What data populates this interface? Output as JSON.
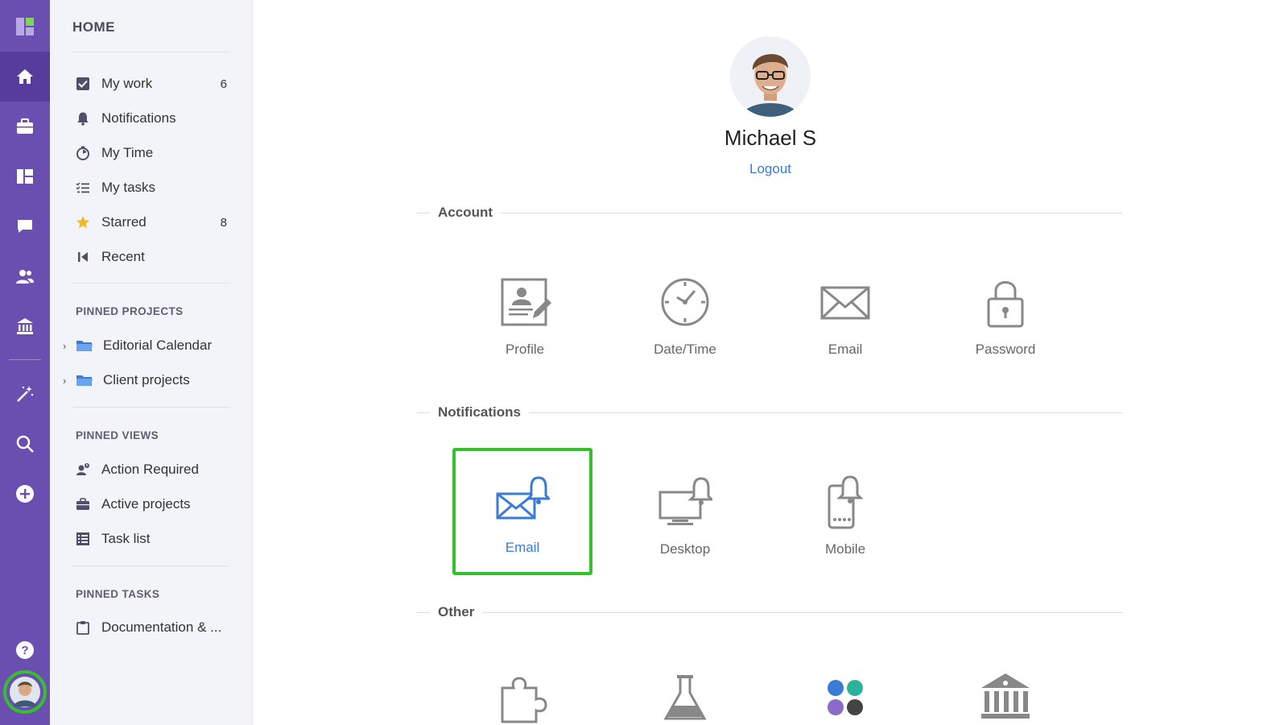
{
  "sidebar": {
    "home_title": "HOME",
    "items": [
      {
        "label": "My work",
        "count": "6",
        "icon": "checkbox-icon"
      },
      {
        "label": "Notifications",
        "count": "",
        "icon": "bell-icon"
      },
      {
        "label": "My Time",
        "count": "",
        "icon": "stopwatch-icon"
      },
      {
        "label": "My tasks",
        "count": "",
        "icon": "checklist-icon"
      },
      {
        "label": "Starred",
        "count": "8",
        "icon": "star-icon"
      },
      {
        "label": "Recent",
        "count": "",
        "icon": "skip-back-icon"
      }
    ],
    "pinned_projects": {
      "title": "PINNED PROJECTS",
      "items": [
        {
          "label": "Editorial Calendar",
          "icon": "folder-icon"
        },
        {
          "label": "Client projects",
          "icon": "folder-icon"
        }
      ]
    },
    "pinned_views": {
      "title": "PINNED VIEWS",
      "items": [
        {
          "label": "Action Required",
          "icon": "user-alert-icon"
        },
        {
          "label": "Active projects",
          "icon": "briefcase-icon"
        },
        {
          "label": "Task list",
          "icon": "table-icon"
        }
      ]
    },
    "pinned_tasks": {
      "title": "PINNED TASKS",
      "items": [
        {
          "label": "Documentation & ...",
          "icon": "clipboard-icon"
        }
      ]
    }
  },
  "user": {
    "name": "Michael S",
    "logout_label": "Logout"
  },
  "sections": {
    "account": {
      "title": "Account",
      "tiles": [
        {
          "label": "Profile",
          "icon": "profile-card-icon"
        },
        {
          "label": "Date/Time",
          "icon": "clock-icon"
        },
        {
          "label": "Email",
          "icon": "envelope-icon"
        },
        {
          "label": "Password",
          "icon": "padlock-icon"
        }
      ]
    },
    "notifications": {
      "title": "Notifications",
      "tiles": [
        {
          "label": "Email",
          "icon": "email-bell-icon",
          "selected": true
        },
        {
          "label": "Desktop",
          "icon": "desktop-bell-icon"
        },
        {
          "label": "Mobile",
          "icon": "mobile-bell-icon"
        }
      ]
    },
    "other": {
      "title": "Other",
      "tiles": [
        {
          "icon": "puzzle-icon"
        },
        {
          "icon": "flask-icon"
        },
        {
          "icon": "color-dots-icon"
        },
        {
          "icon": "institution-icon"
        }
      ]
    }
  },
  "colors": {
    "rail": "#6a4fb0",
    "rail_active": "#573c9c",
    "accent_blue": "#3a7bd5",
    "selection_green": "#35c02c",
    "star": "#f5b62a"
  }
}
